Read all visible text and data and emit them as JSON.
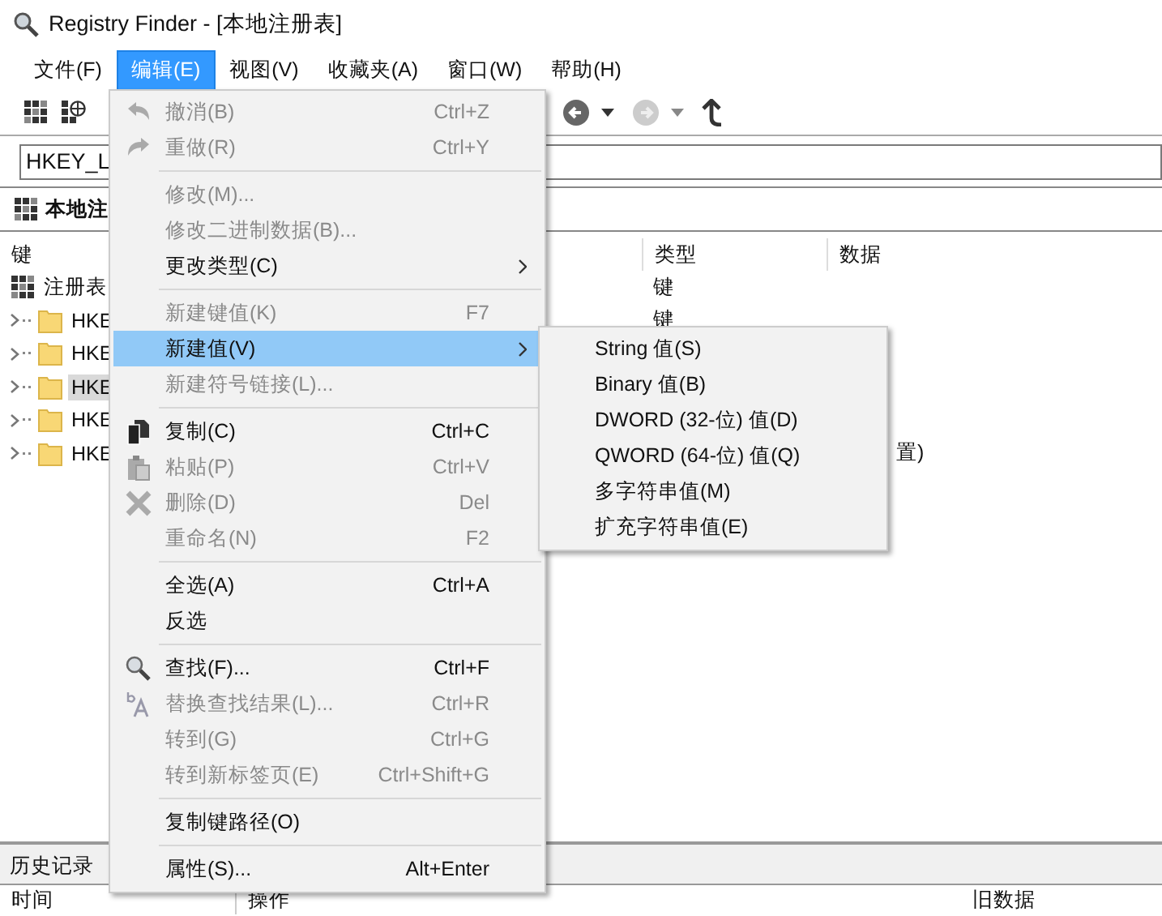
{
  "window": {
    "title": "Registry Finder - [本地注册表]"
  },
  "menubar": [
    {
      "label": "文件(F)",
      "selected": false
    },
    {
      "label": "编辑(E)",
      "selected": true
    },
    {
      "label": "视图(V)",
      "selected": false
    },
    {
      "label": "收藏夹(A)",
      "selected": false
    },
    {
      "label": "窗口(W)",
      "selected": false
    },
    {
      "label": "帮助(H)",
      "selected": false
    }
  ],
  "address": {
    "value": "HKEY_L"
  },
  "tabs": [
    {
      "label": "本地注"
    }
  ],
  "table": {
    "columns": [
      "键",
      "类型",
      "数据"
    ],
    "tree": [
      {
        "label": "注册表",
        "type": "键",
        "selected": false,
        "children": [
          {
            "label": "HKE",
            "type": "键",
            "selected": false,
            "expanded": false
          },
          {
            "label": "HKE",
            "selected": false,
            "expanded": false
          },
          {
            "label": "HKE",
            "selected": true,
            "expanded": false
          },
          {
            "label": "HKE",
            "selected": false,
            "expanded": false
          },
          {
            "label": "HKE",
            "data": "置)",
            "selected": false,
            "expanded": false
          }
        ]
      }
    ]
  },
  "history": {
    "tab": "历史记录",
    "columns": [
      "时间",
      "操作",
      "旧数据"
    ]
  },
  "edit_menu": [
    {
      "kind": "item",
      "label": "撤消(B)",
      "shortcut": "Ctrl+Z",
      "disabled": true
    },
    {
      "kind": "item",
      "label": "重做(R)",
      "shortcut": "Ctrl+Y",
      "disabled": true
    },
    {
      "kind": "separator"
    },
    {
      "kind": "item",
      "label": "修改(M)...",
      "disabled": true
    },
    {
      "kind": "item",
      "label": "修改二进制数据(B)...",
      "disabled": true
    },
    {
      "kind": "item",
      "label": "更改类型(C)",
      "disabled": false,
      "submenu": true
    },
    {
      "kind": "separator"
    },
    {
      "kind": "item",
      "label": "新建键值(K)",
      "shortcut": "F7",
      "disabled": true
    },
    {
      "kind": "item",
      "label": "新建值(V)",
      "disabled": false,
      "submenu": true,
      "selected": true
    },
    {
      "kind": "item",
      "label": "新建符号链接(L)...",
      "disabled": true
    },
    {
      "kind": "separator"
    },
    {
      "kind": "item",
      "label": "复制(C)",
      "shortcut": "Ctrl+C",
      "disabled": false
    },
    {
      "kind": "item",
      "label": "粘贴(P)",
      "shortcut": "Ctrl+V",
      "disabled": true
    },
    {
      "kind": "item",
      "label": "删除(D)",
      "shortcut": "Del",
      "disabled": true
    },
    {
      "kind": "item",
      "label": "重命名(N)",
      "shortcut": "F2",
      "disabled": true
    },
    {
      "kind": "separator"
    },
    {
      "kind": "item",
      "label": "全选(A)",
      "shortcut": "Ctrl+A",
      "disabled": false
    },
    {
      "kind": "item",
      "label": "反选",
      "disabled": false
    },
    {
      "kind": "separator"
    },
    {
      "kind": "item",
      "label": "查找(F)...",
      "shortcut": "Ctrl+F",
      "disabled": false
    },
    {
      "kind": "item",
      "label": "替换查找结果(L)...",
      "shortcut": "Ctrl+R",
      "disabled": true
    },
    {
      "kind": "item",
      "label": "转到(G)",
      "shortcut": "Ctrl+G",
      "disabled": true
    },
    {
      "kind": "item",
      "label": "转到新标签页(E)",
      "shortcut": "Ctrl+Shift+G",
      "disabled": true
    },
    {
      "kind": "separator"
    },
    {
      "kind": "item",
      "label": "复制键路径(O)",
      "disabled": false
    },
    {
      "kind": "separator"
    },
    {
      "kind": "item",
      "label": "属性(S)...",
      "shortcut": "Alt+Enter",
      "disabled": false
    }
  ],
  "submenu": [
    {
      "label": "String 值(S)"
    },
    {
      "label": "Binary 值(B)"
    },
    {
      "label": "DWORD (32-位) 值(D)"
    },
    {
      "label": "QWORD (64-位) 值(Q)"
    },
    {
      "label": "多字符串值(M)"
    },
    {
      "label": "扩充字符串值(E)"
    }
  ]
}
